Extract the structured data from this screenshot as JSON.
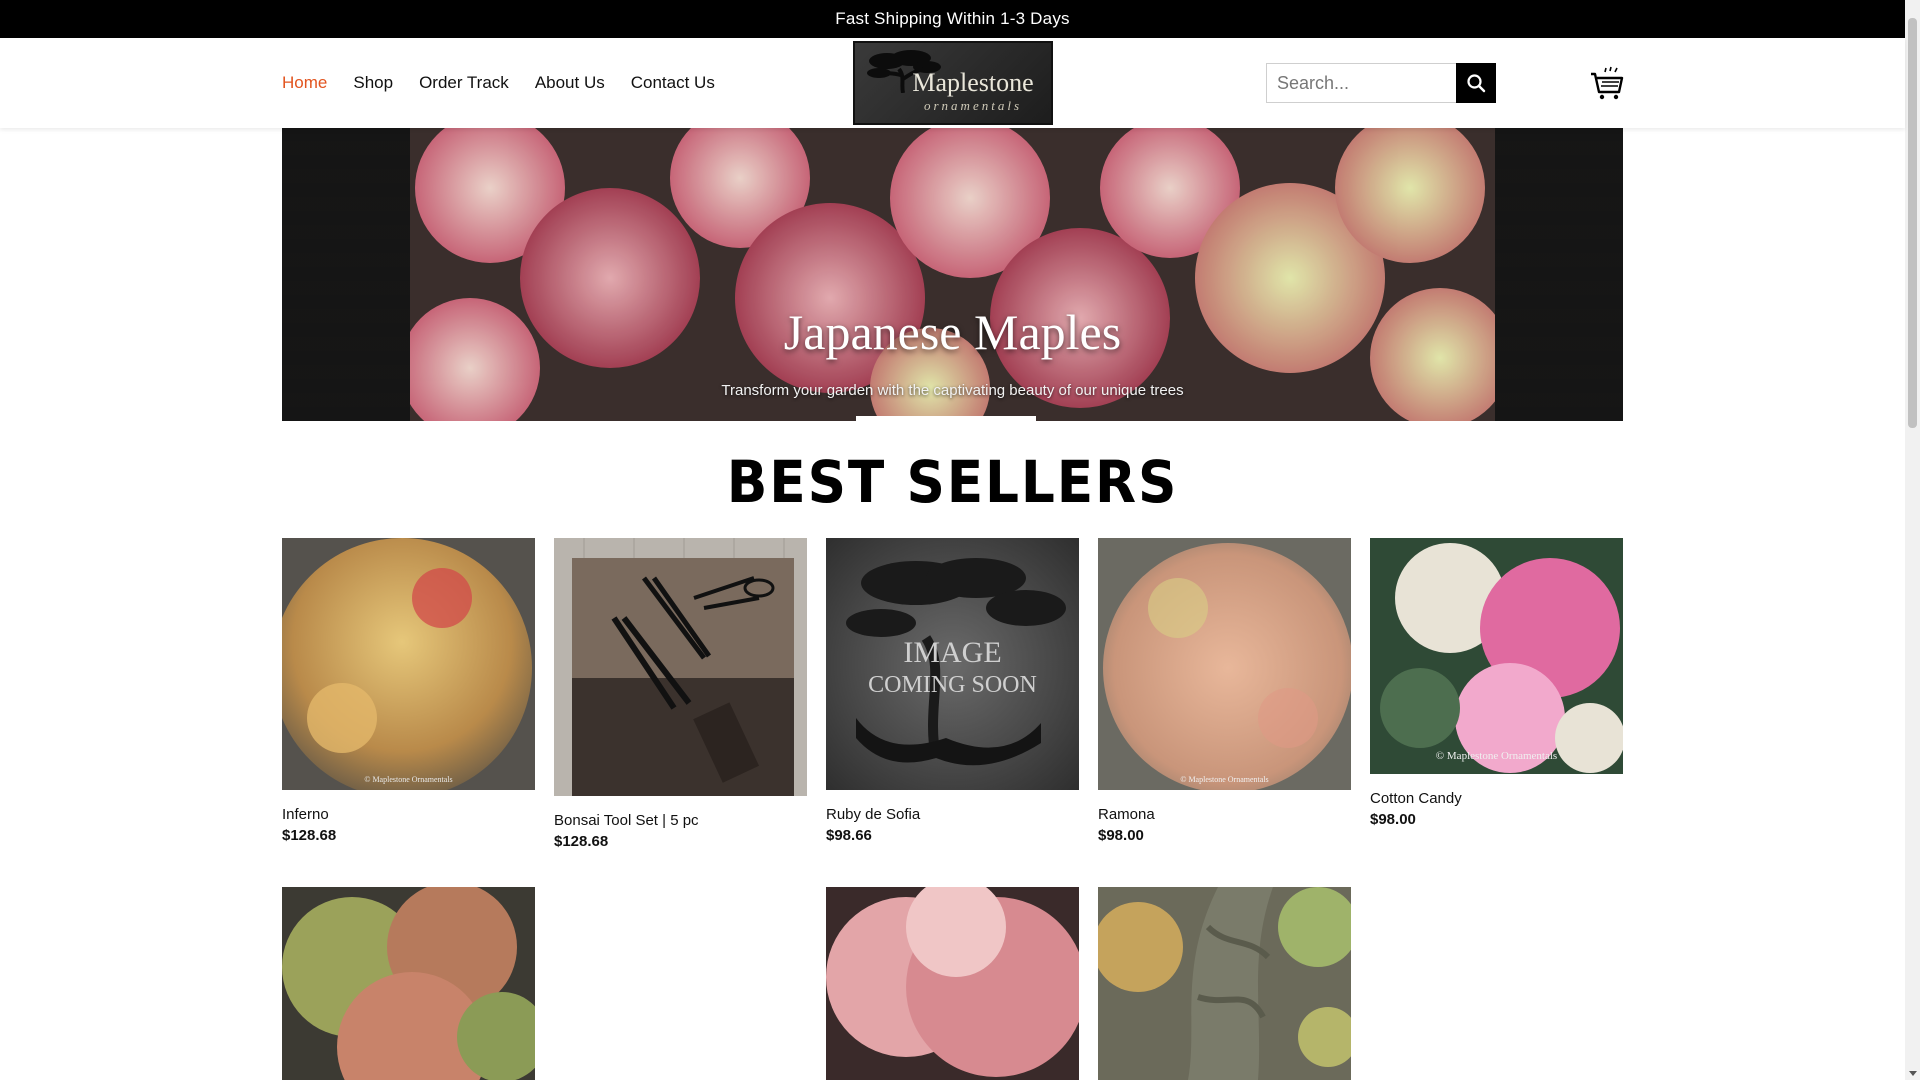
{
  "topbar": {
    "text": "Fast Shipping Within 1-3 Days"
  },
  "nav": {
    "items": [
      {
        "label": "Home",
        "active": true
      },
      {
        "label": "Shop",
        "active": false
      },
      {
        "label": "Order Track",
        "active": false
      },
      {
        "label": "About Us",
        "active": false
      },
      {
        "label": "Contact Us",
        "active": false
      }
    ]
  },
  "logo": {
    "name": "Maplestone",
    "sub": "ornamentals"
  },
  "search": {
    "placeholder": "Search..."
  },
  "hero": {
    "title": "Japanese Maples",
    "subtitle": "Transform your garden with the captivating beauty of our unique trees"
  },
  "section": {
    "title": "BEST SELLERS"
  },
  "products": [
    {
      "name": "Inferno",
      "price": "$128.68",
      "watermark": "© Maplestone Ornamentals"
    },
    {
      "name": "Bonsai Tool Set | 5 pc",
      "price": "$128.68"
    },
    {
      "name": "Ruby de Sofia",
      "price": "$98.66",
      "placeholder_line1": "IMAGE",
      "placeholder_line2": "COMING SOON"
    },
    {
      "name": "Ramona",
      "price": "$98.00",
      "watermark": "© Maplestone Ornamentals"
    },
    {
      "name": "Cotton Candy",
      "price": "$98.00",
      "watermark": "© Maplestone Ornamentals"
    }
  ],
  "colors": {
    "accent": "#e2541f",
    "topbar": "#000000"
  }
}
